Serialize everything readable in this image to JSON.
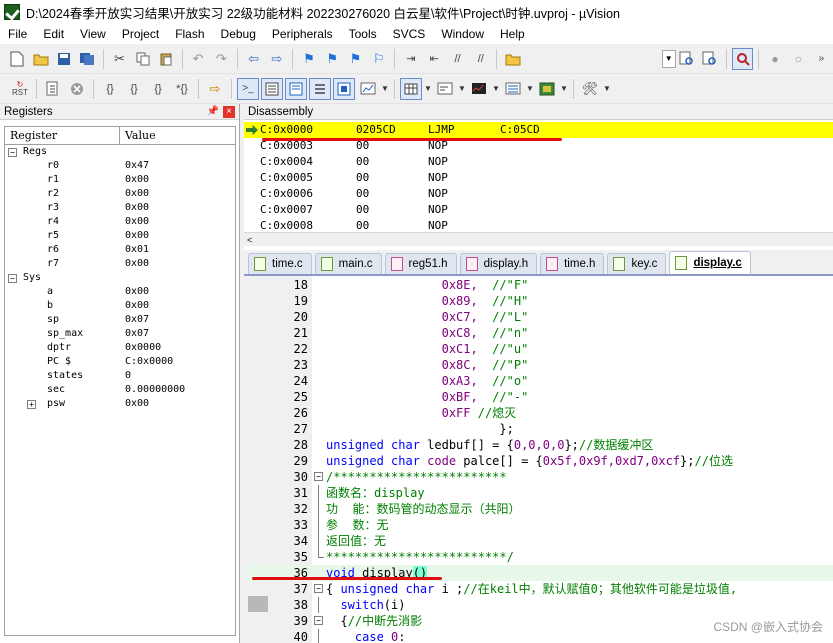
{
  "window": {
    "title": "D:\\2024春季开放实习结果\\开放实习 22级功能材料 202230276020 白云星\\软件\\Project\\时钟.uvproj - µVision",
    "icon": "uvision-app-icon"
  },
  "menu": [
    "File",
    "Edit",
    "View",
    "Project",
    "Flash",
    "Debug",
    "Peripherals",
    "Tools",
    "SVCS",
    "Window",
    "Help"
  ],
  "toolbar1": {
    "icons": [
      "new-file-icon",
      "open-file-icon",
      "save-icon",
      "save-all-icon",
      "cut-icon",
      "copy-icon",
      "paste-icon",
      "undo-icon",
      "redo-icon",
      "nav-back-icon",
      "nav-forward-icon",
      "bookmark-icon",
      "prev-bookmark-icon",
      "next-bookmark-icon",
      "clear-bookmarks-icon",
      "indent-icon",
      "unindent-icon",
      "comment-icon",
      "uncomment-icon",
      "find-in-files-icon",
      "target-combo",
      "find-icon",
      "incremental-find-icon",
      "debug-session-icon",
      "breakpoint-icon",
      "disable-breakpoint-icon",
      "more-icon"
    ]
  },
  "toolbar2": {
    "rst_label": "RST",
    "icons": [
      "reset-icon",
      "run-icon",
      "stop-icon",
      "step-into-icon",
      "step-over-icon",
      "step-out-icon",
      "run-to-cursor-icon",
      "show-next-statement-icon",
      "command-window-icon",
      "disassembly-window-icon",
      "symbols-window-icon",
      "registers-window-icon",
      "call-stack-icon",
      "watch-window-icon",
      "memory-window-icon",
      "serial-window-icon",
      "analysis-window-icon",
      "trace-window-icon",
      "system-viewer-icon",
      "toolbox-icon"
    ]
  },
  "registers": {
    "panel_title": "Registers",
    "col_register": "Register",
    "col_value": "Value",
    "groups": [
      {
        "name": "Regs",
        "expand": "−",
        "items": [
          {
            "name": "r0",
            "value": "0x47"
          },
          {
            "name": "r1",
            "value": "0x00"
          },
          {
            "name": "r2",
            "value": "0x00"
          },
          {
            "name": "r3",
            "value": "0x00"
          },
          {
            "name": "r4",
            "value": "0x00"
          },
          {
            "name": "r5",
            "value": "0x00"
          },
          {
            "name": "r6",
            "value": "0x01"
          },
          {
            "name": "r7",
            "value": "0x00"
          }
        ]
      },
      {
        "name": "Sys",
        "expand": "−",
        "items": [
          {
            "name": "a",
            "value": "0x00"
          },
          {
            "name": "b",
            "value": "0x00"
          },
          {
            "name": "sp",
            "value": "0x07"
          },
          {
            "name": "sp_max",
            "value": "0x07"
          },
          {
            "name": "dptr",
            "value": "0x0000"
          },
          {
            "name": "PC  $",
            "value": "C:0x0000"
          },
          {
            "name": "states",
            "value": "0"
          },
          {
            "name": "sec",
            "value": "0.00000000"
          },
          {
            "name": "psw",
            "value": "0x00",
            "expand": "+"
          }
        ]
      }
    ]
  },
  "disassembly": {
    "panel_title": "Disassembly",
    "lines": [
      {
        "addr": "C:0x0000",
        "bytes": "0205CD",
        "mnemonic": "LJMP",
        "operand": "C:05CD",
        "current": true
      },
      {
        "addr": "C:0x0003",
        "bytes": "00",
        "mnemonic": "NOP",
        "operand": ""
      },
      {
        "addr": "C:0x0004",
        "bytes": "00",
        "mnemonic": "NOP",
        "operand": ""
      },
      {
        "addr": "C:0x0005",
        "bytes": "00",
        "mnemonic": "NOP",
        "operand": ""
      },
      {
        "addr": "C:0x0006",
        "bytes": "00",
        "mnemonic": "NOP",
        "operand": ""
      },
      {
        "addr": "C:0x0007",
        "bytes": "00",
        "mnemonic": "NOP",
        "operand": ""
      },
      {
        "addr": "C:0x0008",
        "bytes": "00",
        "mnemonic": "NOP",
        "operand": ""
      }
    ],
    "scroll_left": "<"
  },
  "tabs": [
    {
      "name": "time.c",
      "type": "c",
      "active": false
    },
    {
      "name": "main.c",
      "type": "c",
      "active": false
    },
    {
      "name": "reg51.h",
      "type": "h",
      "active": false
    },
    {
      "name": "display.h",
      "type": "h",
      "active": false
    },
    {
      "name": "time.h",
      "type": "h",
      "active": false
    },
    {
      "name": "key.c",
      "type": "c",
      "active": false
    },
    {
      "name": "display.c",
      "type": "c",
      "active": true
    }
  ],
  "editor": {
    "lines": [
      {
        "n": "18",
        "segs": [
          {
            "t": "                0x8E,  ",
            "c": "num"
          },
          {
            "t": "//\"F\"",
            "c": "cm"
          }
        ]
      },
      {
        "n": "19",
        "segs": [
          {
            "t": "                0x89,  ",
            "c": "num"
          },
          {
            "t": "//\"H\"",
            "c": "cm"
          }
        ]
      },
      {
        "n": "20",
        "segs": [
          {
            "t": "                0xC7,  ",
            "c": "num"
          },
          {
            "t": "//\"L\"",
            "c": "cm"
          }
        ]
      },
      {
        "n": "21",
        "segs": [
          {
            "t": "                0xC8,  ",
            "c": "num"
          },
          {
            "t": "//\"n\"",
            "c": "cm"
          }
        ]
      },
      {
        "n": "22",
        "segs": [
          {
            "t": "                0xC1,  ",
            "c": "num"
          },
          {
            "t": "//\"u\"",
            "c": "cm"
          }
        ]
      },
      {
        "n": "23",
        "segs": [
          {
            "t": "                0x8C,  ",
            "c": "num"
          },
          {
            "t": "//\"P\"",
            "c": "cm"
          }
        ]
      },
      {
        "n": "24",
        "segs": [
          {
            "t": "                0xA3,  ",
            "c": "num"
          },
          {
            "t": "//\"o\"",
            "c": "cm"
          }
        ]
      },
      {
        "n": "25",
        "segs": [
          {
            "t": "                0xBF,  ",
            "c": "num"
          },
          {
            "t": "//\"-\"",
            "c": "cm"
          }
        ]
      },
      {
        "n": "26",
        "segs": [
          {
            "t": "                0xFF ",
            "c": "num"
          },
          {
            "t": "//熄灭",
            "c": "cm"
          }
        ]
      },
      {
        "n": "27",
        "segs": [
          {
            "t": "                        };",
            "c": "plain"
          }
        ]
      },
      {
        "n": "28",
        "segs": [
          {
            "t": "unsigned char ",
            "c": "kw"
          },
          {
            "t": "ledbuf[] = {",
            "c": "plain"
          },
          {
            "t": "0,0,0,0",
            "c": "num"
          },
          {
            "t": "};",
            "c": "plain"
          },
          {
            "t": "//数据缓冲区",
            "c": "cm"
          }
        ]
      },
      {
        "n": "29",
        "segs": [
          {
            "t": "unsigned char ",
            "c": "kw"
          },
          {
            "t": "code ",
            "c": "num"
          },
          {
            "t": "palce[] = {",
            "c": "plain"
          },
          {
            "t": "0x5f,0x9f,0xd7,0xcf",
            "c": "num"
          },
          {
            "t": "};",
            "c": "plain"
          },
          {
            "t": "//位选",
            "c": "cm"
          }
        ]
      },
      {
        "n": "30",
        "fold": "box",
        "segs": [
          {
            "t": "/************************",
            "c": "cm"
          }
        ]
      },
      {
        "n": "31",
        "fold": "line",
        "segs": [
          {
            "t": "函数名：display",
            "c": "cm"
          }
        ]
      },
      {
        "n": "32",
        "fold": "line",
        "segs": [
          {
            "t": "功  能：数码管的动态显示（共阳）",
            "c": "cm"
          }
        ]
      },
      {
        "n": "33",
        "fold": "line",
        "segs": [
          {
            "t": "参  数：无",
            "c": "cm"
          }
        ]
      },
      {
        "n": "34",
        "fold": "line",
        "segs": [
          {
            "t": "返回值：无",
            "c": "cm"
          }
        ]
      },
      {
        "n": "35",
        "fold": "end",
        "segs": [
          {
            "t": "*************************/",
            "c": "cm"
          }
        ]
      },
      {
        "n": "36",
        "hl": true,
        "segs": [
          {
            "t": "void ",
            "c": "kw"
          },
          {
            "t": "display",
            "c": "plain"
          },
          {
            "t": "()",
            "c": "bracket"
          }
        ]
      },
      {
        "n": "37",
        "fold": "box",
        "segs": [
          {
            "t": "{ ",
            "c": "plain"
          },
          {
            "t": "unsigned char ",
            "c": "kw"
          },
          {
            "t": "i ;",
            "c": "plain"
          },
          {
            "t": "//在keil中，默认赋值0；其他软件可能是垃圾值,",
            "c": "cm"
          }
        ]
      },
      {
        "n": "38",
        "fold": "line",
        "segs": [
          {
            "t": "  switch",
            "c": "kw"
          },
          {
            "t": "(i)",
            "c": "plain"
          }
        ]
      },
      {
        "n": "39",
        "fold": "box",
        "segs": [
          {
            "t": "  {",
            "c": "plain"
          },
          {
            "t": "//中断先消影",
            "c": "cm"
          }
        ]
      },
      {
        "n": "40",
        "fold": "line",
        "segs": [
          {
            "t": "    case ",
            "c": "kw"
          },
          {
            "t": "0",
            "c": "num"
          },
          {
            "t": ":",
            "c": "plain"
          }
        ]
      }
    ]
  },
  "watermark": "CSDN @嵌入式协会"
}
